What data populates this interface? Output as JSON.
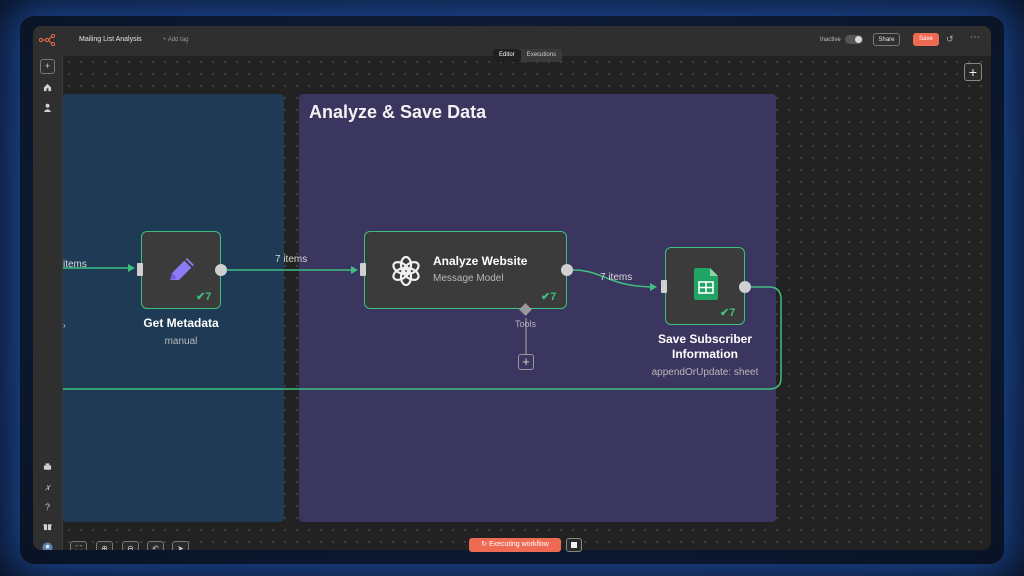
{
  "window": {
    "title": "Mailing List Analysis",
    "add_tag": "+ Add tag",
    "tabs": [
      "Editor",
      "Executions"
    ],
    "active_tab": "Editor",
    "status_label": "Inactive",
    "share_label": "Share",
    "save_label": "Save",
    "accent_color": "#ee6a52"
  },
  "rail": {
    "top": [
      "plus-icon",
      "home-icon",
      "user-icon"
    ],
    "bottom": [
      "templates-icon",
      "variables-icon",
      "help-icon",
      "gift-icon",
      "avatar"
    ],
    "variables_glyph": "𝑥",
    "help_glyph": "?"
  },
  "canvas": {
    "sticky_purple_title": "Analyze & Save Data",
    "nodes": {
      "get_metadata": {
        "title": "Get Metadata",
        "subtitle": "manual",
        "count": "7"
      },
      "analyze_website": {
        "title": "Analyze Website",
        "subtitle": "Message Model",
        "count": "7",
        "tools_label": "Tools"
      },
      "save_subscriber": {
        "title": "Save Subscriber Information",
        "subtitle": "appendOrUpdate: sheet",
        "count": "7"
      }
    },
    "connections": {
      "incoming_label": "items",
      "metadata_to_analyze": "7 items",
      "analyze_to_save": "7 items"
    }
  },
  "footer": {
    "zoom_controls": [
      "fit-view-icon",
      "zoom-in-icon",
      "zoom-out-icon",
      "reset-zoom-icon",
      "pointer-icon"
    ],
    "execute_label": "Executing workflow"
  }
}
